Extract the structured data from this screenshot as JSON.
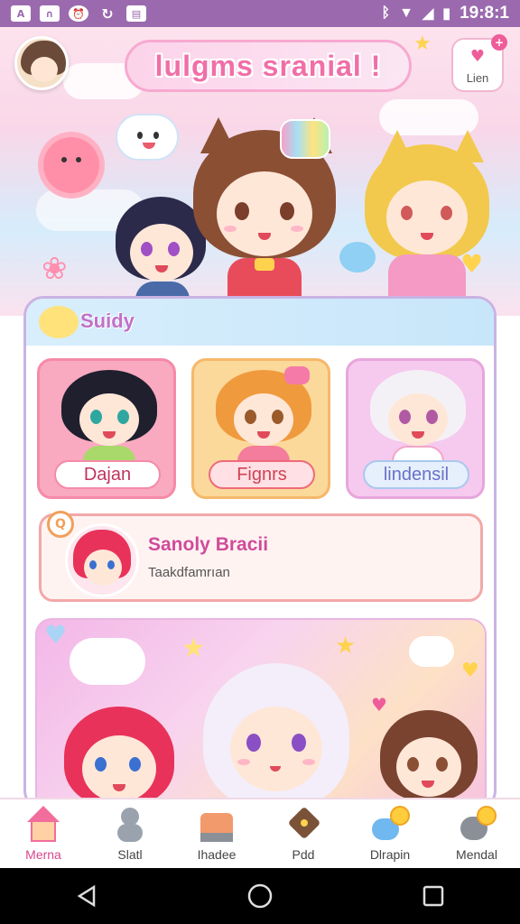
{
  "status_bar": {
    "time": "19:8:1",
    "left_icons": [
      "app-icon-a",
      "app-icon-ma",
      "alarm-icon",
      "sync-icon",
      "gallery-icon"
    ],
    "right_icons": [
      "bluetooth-icon",
      "wifi-icon",
      "signal-icon",
      "battery-icon"
    ]
  },
  "header": {
    "title": "lulgms sranial !",
    "top_button_label": "Lien",
    "top_button_badge": "+"
  },
  "panel": {
    "title": "Suidy",
    "characters": [
      {
        "name": "Dajan"
      },
      {
        "name": "Fignrs"
      },
      {
        "name": "lindensil"
      }
    ],
    "info": {
      "name": "Sanoly Bracii",
      "subtitle": "Taakdfamrıan"
    }
  },
  "bottom_nav": {
    "items": [
      {
        "label": "Merna",
        "icon": "house-icon"
      },
      {
        "label": "Slatl",
        "icon": "figure-icon"
      },
      {
        "label": "Ihadee",
        "icon": "shop-icon"
      },
      {
        "label": "Pdd",
        "icon": "diamond-icon"
      },
      {
        "label": "Dlrapin",
        "icon": "brush-icon"
      },
      {
        "label": "Mendal",
        "icon": "medal-icon"
      }
    ]
  },
  "colors": {
    "accent_pink": "#f06fa8",
    "status_bar": "#9b6aae",
    "panel_border": "#c9b3e4"
  }
}
